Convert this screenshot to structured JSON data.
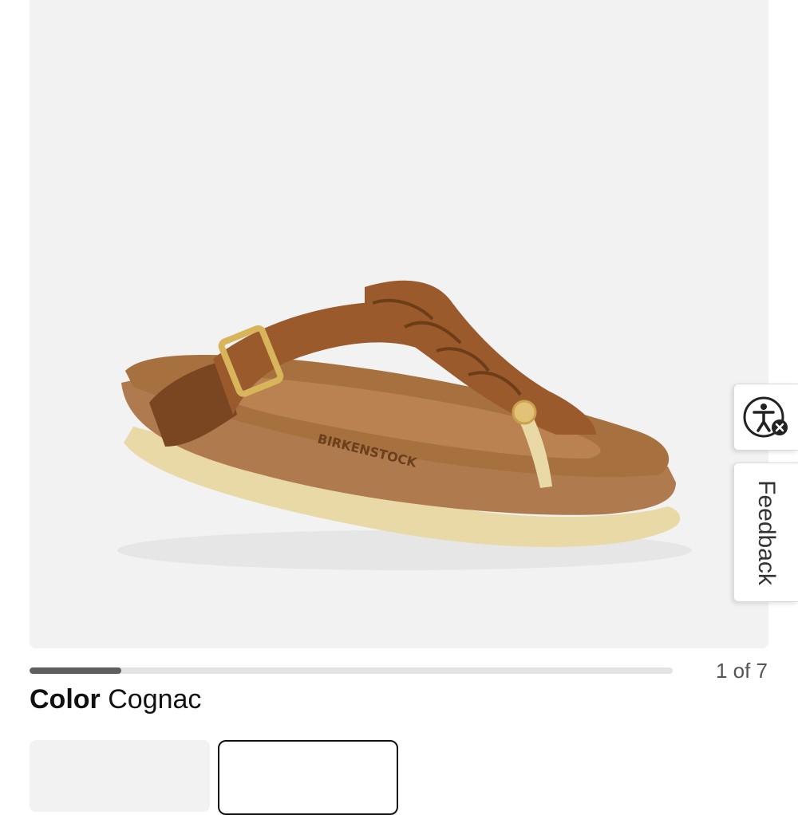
{
  "gallery": {
    "image_description_icon": "sandal-product-photo",
    "counter": "1 of 7",
    "progress_fraction": 0.143
  },
  "product": {
    "color_label": "Color",
    "color_value": "Cognac",
    "brand_emboss": "BIRKENSTOCK"
  },
  "side_tabs": {
    "accessibility_icon": "accessibility-icon",
    "feedback_label": "Feedback"
  },
  "colors": {
    "accent": "#5f5f5f",
    "image_bg": "#f2f2f2",
    "leather": "#9a5a2c",
    "cork": "#b07a4f",
    "sole": "#e8d9a6"
  }
}
